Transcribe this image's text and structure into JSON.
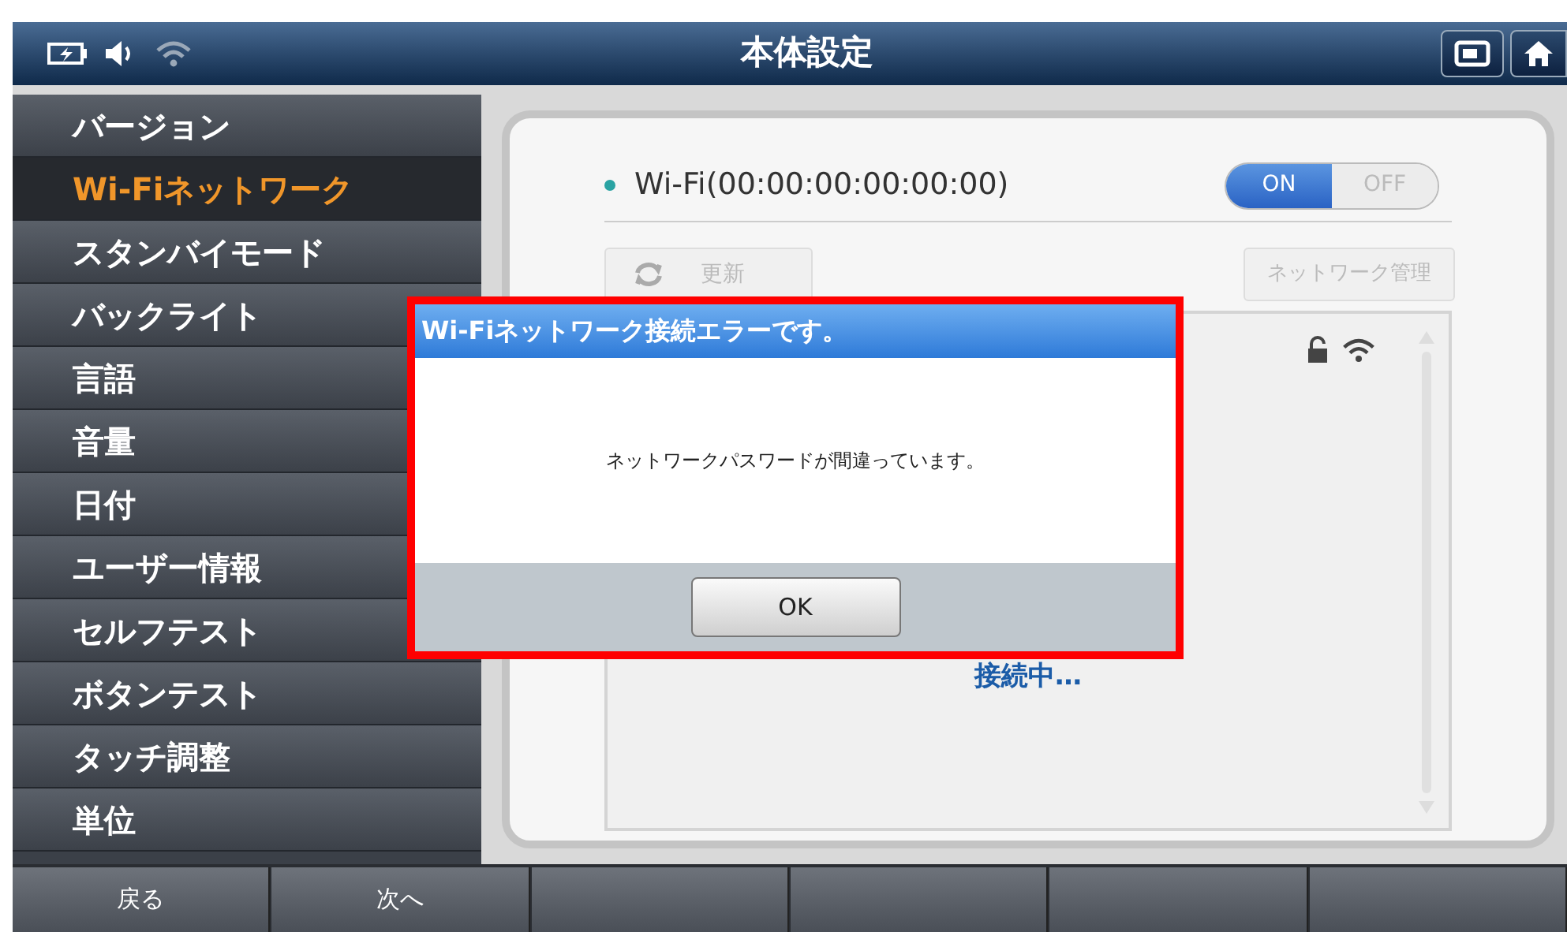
{
  "header": {
    "title": "本体設定"
  },
  "sidebar": {
    "items": [
      {
        "label": "バージョン",
        "selected": false
      },
      {
        "label": "Wi-Fiネットワーク",
        "selected": true
      },
      {
        "label": "スタンバイモード",
        "selected": false
      },
      {
        "label": "バックライト",
        "selected": false
      },
      {
        "label": "言語",
        "selected": false
      },
      {
        "label": "音量",
        "selected": false
      },
      {
        "label": "日付",
        "selected": false
      },
      {
        "label": "ユーザー情報",
        "selected": false
      },
      {
        "label": "セルフテスト",
        "selected": false
      },
      {
        "label": "ボタンテスト",
        "selected": false
      },
      {
        "label": "タッチ調整",
        "selected": false
      },
      {
        "label": "単位",
        "selected": false
      }
    ]
  },
  "wifi": {
    "label": "Wi-Fi(00:00:00:00:00:00)",
    "toggle": [
      {
        "label": "ON",
        "selected": true
      },
      {
        "label": "OFF",
        "selected": false
      }
    ],
    "refresh_button": {
      "label": "更新",
      "disabled": true
    },
    "manage_button": {
      "label": "ネットワーク管理",
      "disabled": true
    },
    "status": "接続中…"
  },
  "dialog": {
    "title": "Wi-Fiネットワーク接続エラーです。",
    "message": "ネットワークパスワードが間違っています。",
    "button": "OK"
  },
  "footer": {
    "buttons": [
      "戻る",
      "次へ"
    ]
  }
}
